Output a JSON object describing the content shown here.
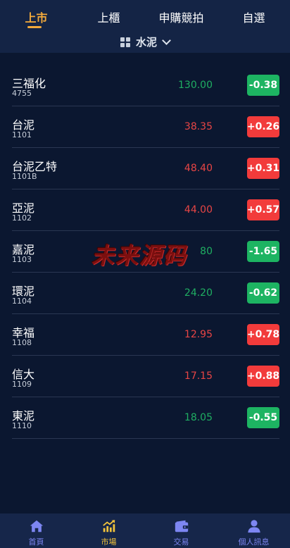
{
  "top_tabs": [
    {
      "label": "上市",
      "active": true
    },
    {
      "label": "上櫃",
      "active": false
    },
    {
      "label": "申購競拍",
      "active": false
    },
    {
      "label": "自選",
      "active": false
    }
  ],
  "category": {
    "label": "水泥",
    "icon": "grid-icon"
  },
  "stocks": [
    {
      "name": "三福化",
      "code": "4755",
      "price": "130.00",
      "change": "-0.38",
      "trend": "down"
    },
    {
      "name": "台泥",
      "code": "1101",
      "price": "38.35",
      "change": "+0.26",
      "trend": "up"
    },
    {
      "name": "台泥乙特",
      "code": "1101B",
      "price": "48.40",
      "change": "+0.31",
      "trend": "up"
    },
    {
      "name": "亞泥",
      "code": "1102",
      "price": "44.00",
      "change": "+0.57",
      "trend": "up"
    },
    {
      "name": "嘉泥",
      "code": "1103",
      "price": "80",
      "change": "-1.65",
      "trend": "down"
    },
    {
      "name": "環泥",
      "code": "1104",
      "price": "24.20",
      "change": "-0.62",
      "trend": "down"
    },
    {
      "name": "幸福",
      "code": "1108",
      "price": "12.95",
      "change": "+0.78",
      "trend": "up"
    },
    {
      "name": "信大",
      "code": "1109",
      "price": "17.15",
      "change": "+0.88",
      "trend": "up"
    },
    {
      "name": "東泥",
      "code": "1110",
      "price": "18.05",
      "change": "-0.55",
      "trend": "down"
    }
  ],
  "watermark": "未来源码",
  "bottom_nav": [
    {
      "label": "首頁",
      "icon": "home-icon",
      "active": false
    },
    {
      "label": "市場",
      "icon": "market-chart-icon",
      "active": true
    },
    {
      "label": "交易",
      "icon": "wallet-icon",
      "active": false
    },
    {
      "label": "個人訊息",
      "icon": "user-icon",
      "active": false
    }
  ],
  "colors": {
    "background": "#0b1730",
    "header": "#142445",
    "accent": "#f2a93b",
    "up": "#f23b3b",
    "down": "#1db462",
    "price_up": "#e84545",
    "price_down": "#1fae62",
    "nav_inactive": "#7d86f2",
    "nav_active": "#f2c33b"
  }
}
